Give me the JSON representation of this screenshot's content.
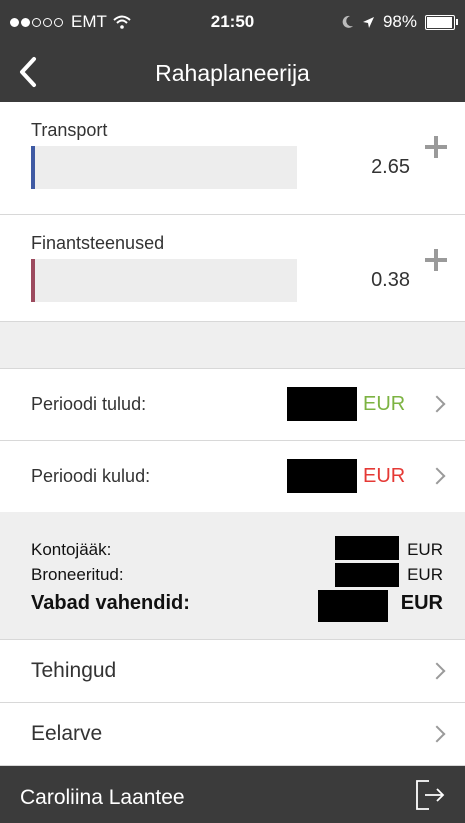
{
  "status_bar": {
    "carrier": "EMT",
    "time": "21:50",
    "battery": "98%",
    "signal_filled_dots": 2,
    "signal_total_dots": 5
  },
  "nav": {
    "title": "Rahaplaneerija"
  },
  "categories": [
    {
      "name": "Transport",
      "value": "2.65",
      "bar_color": "#3f5aa3"
    },
    {
      "name": "Finantsteenused",
      "value": "0.38",
      "bar_color": "#9c4a5e"
    }
  ],
  "period_rows": [
    {
      "label": "Perioodi tulud:",
      "currency": "EUR",
      "currency_color": "#7cb342"
    },
    {
      "label": "Perioodi kulud:",
      "currency": "EUR",
      "currency_color": "#e53935"
    }
  ],
  "summary": {
    "balance_label": "Kontojääk:",
    "balance_currency": "EUR",
    "reserved_label": "Broneeritud:",
    "reserved_currency": "EUR",
    "free_label": "Vabad vahendid:",
    "free_currency": "EUR"
  },
  "menu": [
    {
      "label": "Tehingud"
    },
    {
      "label": "Eelarve"
    }
  ],
  "footer": {
    "user_name": "Caroliina Laantee"
  },
  "colors": {
    "header_bg": "#3b3b3b",
    "income_green": "#7cb342",
    "expense_red": "#e53935"
  }
}
